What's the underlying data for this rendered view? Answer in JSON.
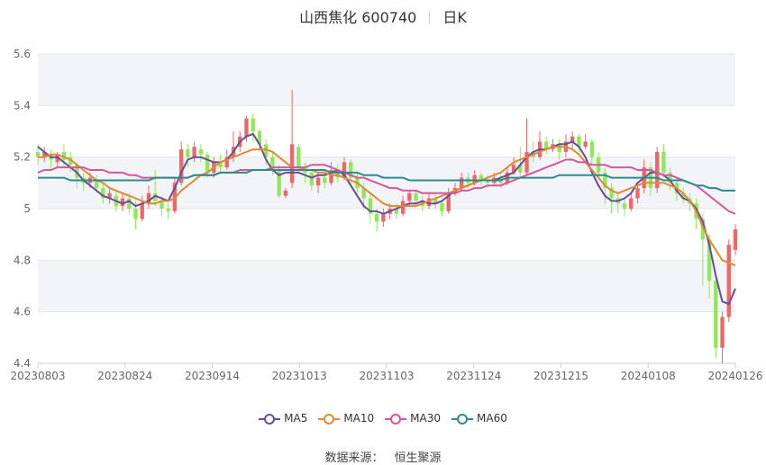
{
  "title": {
    "name": "山西焦化 600740",
    "period": "日K"
  },
  "source": {
    "label": "数据来源：",
    "value": "恒生聚源"
  },
  "colors": {
    "up": "#ee6666",
    "down": "#91e75a",
    "ma5": "#6a4b9c",
    "ma10": "#e08a32",
    "ma30": "#d4569b",
    "ma60": "#2e8b8b",
    "band": "#f3f4f8",
    "grid": "#e3e6ee",
    "axis_text": "#666666"
  },
  "chart_data": {
    "type": "candlestick",
    "ylim": [
      4.4,
      5.6
    ],
    "y_ticks": [
      "4.4",
      "4.6",
      "4.8",
      "5",
      "5.2",
      "5.4",
      "5.6"
    ],
    "x_ticks": [
      "20230803",
      "20230824",
      "20230914",
      "20231013",
      "20231103",
      "20231124",
      "20231215",
      "20240108",
      "20240126"
    ],
    "legend": [
      "MA5",
      "MA10",
      "MA30",
      "MA60"
    ],
    "candles": [
      [
        5.22,
        5.2,
        5.25,
        5.17
      ],
      [
        5.2,
        5.22,
        5.24,
        5.18
      ],
      [
        5.21,
        5.19,
        5.23,
        5.15
      ],
      [
        5.18,
        5.21,
        5.22,
        5.16
      ],
      [
        5.22,
        5.19,
        5.25,
        5.16
      ],
      [
        5.2,
        5.17,
        5.22,
        5.14
      ],
      [
        5.17,
        5.12,
        5.18,
        5.08
      ],
      [
        5.12,
        5.1,
        5.14,
        5.07
      ],
      [
        5.1,
        5.12,
        5.14,
        5.08
      ],
      [
        5.11,
        5.08,
        5.13,
        5.06
      ],
      [
        5.08,
        5.04,
        5.1,
        5.02
      ],
      [
        5.04,
        5.06,
        5.08,
        5.02
      ],
      [
        5.05,
        5.01,
        5.07,
        4.99
      ],
      [
        5.01,
        5.04,
        5.06,
        4.99
      ],
      [
        5.04,
        5.0,
        5.06,
        4.98
      ],
      [
        5.0,
        4.96,
        5.03,
        4.92
      ],
      [
        4.96,
        5.02,
        5.05,
        4.95
      ],
      [
        5.02,
        5.06,
        5.09,
        5.0
      ],
      [
        5.06,
        5.03,
        5.15,
        5.01
      ],
      [
        5.03,
        5.0,
        5.05,
        4.97
      ],
      [
        5.0,
        4.99,
        5.02,
        4.96
      ],
      [
        4.99,
        5.1,
        5.12,
        4.98
      ],
      [
        5.1,
        5.23,
        5.26,
        5.09
      ],
      [
        5.23,
        5.2,
        5.25,
        5.16
      ],
      [
        5.2,
        5.24,
        5.26,
        5.18
      ],
      [
        5.23,
        5.21,
        5.25,
        5.18
      ],
      [
        5.21,
        5.14,
        5.22,
        5.12
      ],
      [
        5.14,
        5.18,
        5.2,
        5.12
      ],
      [
        5.18,
        5.16,
        5.21,
        5.14
      ],
      [
        5.16,
        5.2,
        5.23,
        5.15
      ],
      [
        5.2,
        5.24,
        5.3,
        5.18
      ],
      [
        5.24,
        5.28,
        5.3,
        5.22
      ],
      [
        5.28,
        5.35,
        5.36,
        5.26
      ],
      [
        5.35,
        5.3,
        5.37,
        5.26
      ],
      [
        5.3,
        5.25,
        5.31,
        5.22
      ],
      [
        5.25,
        5.2,
        5.27,
        5.17
      ],
      [
        5.2,
        5.15,
        5.22,
        5.13
      ],
      [
        5.15,
        5.05,
        5.17,
        5.04
      ],
      [
        5.05,
        5.07,
        5.08,
        5.04
      ],
      [
        5.1,
        5.25,
        5.46,
        5.08
      ],
      [
        5.24,
        5.16,
        5.25,
        5.14
      ],
      [
        5.16,
        5.14,
        5.18,
        5.1
      ],
      [
        5.14,
        5.09,
        5.15,
        5.07
      ],
      [
        5.09,
        5.12,
        5.14,
        5.06
      ],
      [
        5.12,
        5.1,
        5.15,
        5.08
      ],
      [
        5.1,
        5.15,
        5.18,
        5.09
      ],
      [
        5.15,
        5.12,
        5.17,
        5.1
      ],
      [
        5.12,
        5.18,
        5.2,
        5.11
      ],
      [
        5.18,
        5.12,
        5.19,
        5.09
      ],
      [
        5.12,
        5.08,
        5.14,
        5.06
      ],
      [
        5.08,
        5.04,
        5.1,
        5.0
      ],
      [
        5.04,
        4.98,
        5.06,
        4.94
      ],
      [
        4.98,
        4.95,
        5.0,
        4.91
      ],
      [
        4.95,
        4.98,
        5.0,
        4.93
      ],
      [
        4.98,
        5.0,
        5.02,
        4.96
      ],
      [
        5.0,
        4.98,
        5.02,
        4.96
      ],
      [
        4.98,
        5.03,
        5.05,
        4.97
      ],
      [
        5.03,
        5.06,
        5.07,
        5.01
      ],
      [
        5.06,
        5.03,
        5.07,
        5.01
      ],
      [
        5.03,
        5.01,
        5.05,
        4.99
      ],
      [
        5.01,
        5.04,
        5.06,
        5.0
      ],
      [
        5.04,
        5.02,
        5.06,
        5.0
      ],
      [
        5.02,
        4.99,
        5.03,
        4.97
      ],
      [
        4.99,
        5.06,
        5.08,
        4.98
      ],
      [
        5.06,
        5.08,
        5.1,
        5.05
      ],
      [
        5.08,
        5.12,
        5.14,
        5.07
      ],
      [
        5.12,
        5.1,
        5.14,
        5.08
      ],
      [
        5.1,
        5.13,
        5.15,
        5.09
      ],
      [
        5.13,
        5.11,
        5.14,
        5.09
      ],
      [
        5.11,
        5.1,
        5.13,
        5.08
      ],
      [
        5.1,
        5.12,
        5.14,
        5.09
      ],
      [
        5.12,
        5.1,
        5.13,
        5.08
      ],
      [
        5.1,
        5.14,
        5.16,
        5.09
      ],
      [
        5.14,
        5.17,
        5.2,
        5.13
      ],
      [
        5.17,
        5.14,
        5.24,
        5.12
      ],
      [
        5.14,
        5.22,
        5.35,
        5.13
      ],
      [
        5.22,
        5.2,
        5.26,
        5.18
      ],
      [
        5.2,
        5.26,
        5.3,
        5.19
      ],
      [
        5.26,
        5.23,
        5.28,
        5.21
      ],
      [
        5.23,
        5.25,
        5.27,
        5.22
      ],
      [
        5.25,
        5.22,
        5.27,
        5.19
      ],
      [
        5.22,
        5.26,
        5.29,
        5.2
      ],
      [
        5.26,
        5.28,
        5.3,
        5.23
      ],
      [
        5.28,
        5.24,
        5.29,
        5.22
      ],
      [
        5.24,
        5.26,
        5.29,
        5.23
      ],
      [
        5.26,
        5.2,
        5.27,
        5.17
      ],
      [
        5.2,
        5.14,
        5.22,
        5.12
      ],
      [
        5.14,
        5.08,
        5.16,
        5.02
      ],
      [
        5.08,
        5.04,
        5.1,
        4.98
      ],
      [
        5.04,
        5.02,
        5.06,
        4.98
      ],
      [
        5.02,
        5.0,
        5.04,
        4.97
      ],
      [
        5.0,
        5.04,
        5.06,
        4.99
      ],
      [
        5.04,
        5.08,
        5.1,
        5.02
      ],
      [
        5.08,
        5.16,
        5.19,
        5.06
      ],
      [
        5.16,
        5.08,
        5.18,
        5.05
      ],
      [
        5.08,
        5.22,
        5.24,
        5.06
      ],
      [
        5.22,
        5.14,
        5.25,
        5.12
      ],
      [
        5.14,
        5.1,
        5.16,
        5.07
      ],
      [
        5.1,
        5.06,
        5.12,
        5.03
      ],
      [
        5.06,
        5.04,
        5.08,
        5.02
      ],
      [
        5.04,
        5.02,
        5.06,
        4.99
      ],
      [
        5.02,
        4.96,
        5.04,
        4.92
      ],
      [
        4.96,
        4.88,
        4.98,
        4.7
      ],
      [
        4.88,
        4.72,
        4.9,
        4.65
      ],
      [
        4.72,
        4.46,
        4.74,
        4.42
      ],
      [
        4.46,
        4.58,
        4.6,
        4.4
      ],
      [
        4.58,
        4.86,
        4.88,
        4.56
      ],
      [
        4.84,
        4.92,
        4.94,
        4.82
      ]
    ],
    "series": [
      {
        "name": "MA5",
        "values": [
          5.24,
          5.22,
          5.2,
          5.2,
          5.18,
          5.16,
          5.14,
          5.11,
          5.09,
          5.07,
          5.05,
          5.04,
          5.03,
          5.02,
          5.03,
          5.01,
          5.02,
          5.03,
          5.05,
          5.04,
          5.03,
          5.08,
          5.14,
          5.19,
          5.2,
          5.2,
          5.19,
          5.18,
          5.18,
          5.19,
          5.22,
          5.26,
          5.28,
          5.29,
          5.25,
          5.19,
          5.15,
          5.13,
          5.14,
          5.14,
          5.14,
          5.13,
          5.12,
          5.13,
          5.13,
          5.14,
          5.15,
          5.13,
          5.09,
          5.05,
          5.01,
          4.99,
          4.99,
          4.98,
          4.99,
          5.0,
          5.01,
          5.02,
          5.02,
          5.03,
          5.02,
          5.02,
          5.03,
          5.05,
          5.07,
          5.08,
          5.09,
          5.1,
          5.11,
          5.11,
          5.11,
          5.12,
          5.13,
          5.14,
          5.17,
          5.2,
          5.22,
          5.23,
          5.23,
          5.24,
          5.25,
          5.25,
          5.26,
          5.24,
          5.2,
          5.14,
          5.09,
          5.05,
          5.03,
          5.03,
          5.04,
          5.06,
          5.1,
          5.12,
          5.14,
          5.14,
          5.13,
          5.11,
          5.07,
          5.04,
          5.03,
          5.0,
          4.95,
          4.86,
          4.74,
          4.64,
          4.63,
          4.69
        ]
      },
      {
        "name": "MA10",
        "values": [
          5.2,
          5.2,
          5.21,
          5.21,
          5.2,
          5.19,
          5.17,
          5.15,
          5.13,
          5.11,
          5.1,
          5.08,
          5.07,
          5.06,
          5.05,
          5.04,
          5.03,
          5.02,
          5.02,
          5.03,
          5.03,
          5.04,
          5.07,
          5.09,
          5.11,
          5.13,
          5.14,
          5.16,
          5.18,
          5.19,
          5.2,
          5.21,
          5.22,
          5.23,
          5.23,
          5.23,
          5.22,
          5.2,
          5.18,
          5.16,
          5.16,
          5.15,
          5.15,
          5.14,
          5.14,
          5.13,
          5.13,
          5.12,
          5.11,
          5.1,
          5.08,
          5.06,
          5.04,
          5.02,
          5.01,
          5.01,
          5.01,
          5.01,
          5.01,
          5.02,
          5.03,
          5.04,
          5.05,
          5.06,
          5.07,
          5.08,
          5.09,
          5.1,
          5.11,
          5.12,
          5.13,
          5.14,
          5.16,
          5.18,
          5.19,
          5.2,
          5.21,
          5.22,
          5.23,
          5.24,
          5.24,
          5.24,
          5.23,
          5.21,
          5.18,
          5.15,
          5.12,
          5.09,
          5.07,
          5.06,
          5.07,
          5.08,
          5.09,
          5.1,
          5.1,
          5.1,
          5.1,
          5.09,
          5.08,
          5.06,
          5.03,
          4.99,
          4.93,
          4.88,
          4.84,
          4.8,
          4.79,
          4.78
        ]
      },
      {
        "name": "MA30",
        "values": [
          5.14,
          5.15,
          5.15,
          5.16,
          5.16,
          5.16,
          5.16,
          5.16,
          5.15,
          5.15,
          5.15,
          5.14,
          5.14,
          5.14,
          5.13,
          5.13,
          5.12,
          5.12,
          5.12,
          5.12,
          5.12,
          5.12,
          5.12,
          5.12,
          5.13,
          5.13,
          5.13,
          5.13,
          5.14,
          5.14,
          5.14,
          5.15,
          5.15,
          5.15,
          5.15,
          5.15,
          5.16,
          5.16,
          5.16,
          5.16,
          5.16,
          5.16,
          5.17,
          5.17,
          5.17,
          5.16,
          5.15,
          5.14,
          5.13,
          5.12,
          5.12,
          5.11,
          5.1,
          5.09,
          5.08,
          5.08,
          5.07,
          5.07,
          5.07,
          5.06,
          5.06,
          5.06,
          5.06,
          5.06,
          5.06,
          5.07,
          5.07,
          5.08,
          5.08,
          5.09,
          5.09,
          5.09,
          5.1,
          5.11,
          5.12,
          5.13,
          5.14,
          5.15,
          5.16,
          5.17,
          5.18,
          5.19,
          5.19,
          5.18,
          5.18,
          5.17,
          5.17,
          5.17,
          5.16,
          5.16,
          5.16,
          5.16,
          5.15,
          5.15,
          5.15,
          5.14,
          5.13,
          5.13,
          5.12,
          5.11,
          5.1,
          5.09,
          5.07,
          5.05,
          5.03,
          5.01,
          4.99,
          4.98
        ]
      },
      {
        "name": "MA60",
        "values": [
          5.12,
          5.12,
          5.12,
          5.12,
          5.12,
          5.11,
          5.11,
          5.11,
          5.11,
          5.11,
          5.11,
          5.11,
          5.11,
          5.11,
          5.11,
          5.11,
          5.11,
          5.11,
          5.12,
          5.12,
          5.12,
          5.12,
          5.12,
          5.12,
          5.13,
          5.13,
          5.13,
          5.13,
          5.14,
          5.14,
          5.14,
          5.14,
          5.14,
          5.15,
          5.15,
          5.15,
          5.15,
          5.15,
          5.15,
          5.15,
          5.15,
          5.15,
          5.15,
          5.15,
          5.15,
          5.14,
          5.14,
          5.14,
          5.14,
          5.14,
          5.13,
          5.13,
          5.13,
          5.12,
          5.12,
          5.12,
          5.12,
          5.11,
          5.11,
          5.11,
          5.11,
          5.11,
          5.11,
          5.11,
          5.11,
          5.11,
          5.11,
          5.11,
          5.11,
          5.11,
          5.11,
          5.11,
          5.12,
          5.12,
          5.12,
          5.12,
          5.12,
          5.12,
          5.12,
          5.12,
          5.13,
          5.13,
          5.13,
          5.13,
          5.13,
          5.13,
          5.13,
          5.13,
          5.12,
          5.12,
          5.12,
          5.12,
          5.12,
          5.12,
          5.12,
          5.12,
          5.11,
          5.11,
          5.11,
          5.11,
          5.1,
          5.09,
          5.09,
          5.08,
          5.08,
          5.07,
          5.07,
          5.07
        ]
      }
    ]
  }
}
